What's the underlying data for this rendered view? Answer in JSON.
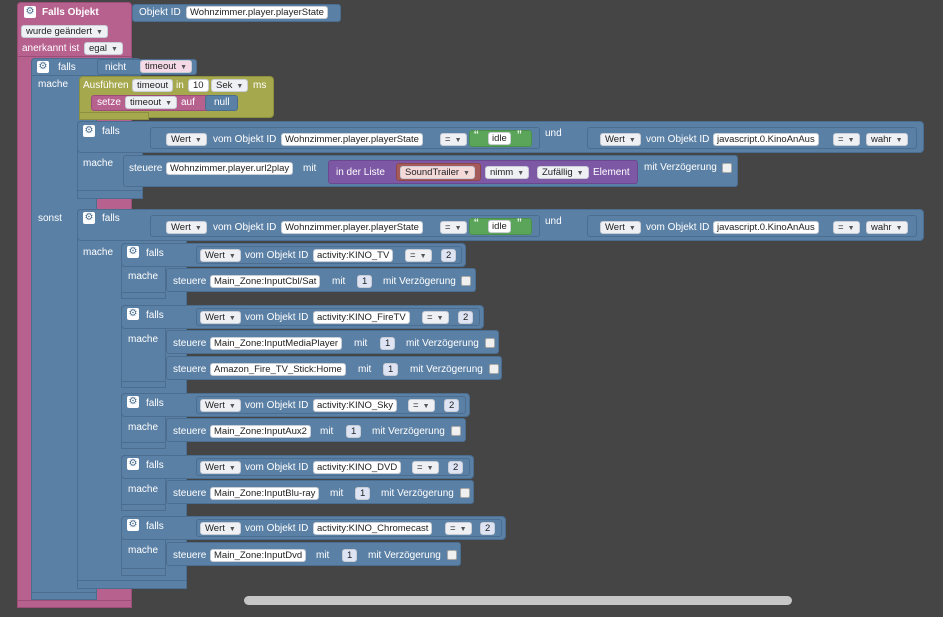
{
  "header": {
    "falls_objekt": "Falls Objekt",
    "objekt_id_label": "Objekt ID",
    "objekt_id_value": "Wohnzimmer.player.playerState",
    "wurde_geaendert": "wurde geändert",
    "anerkannt_ist": "anerkannt ist",
    "egal": "egal"
  },
  "outer_if": {
    "falls": "falls",
    "nicht": "nicht",
    "timeout_var": "timeout",
    "mache": "mache",
    "sonst": "sonst"
  },
  "timer": {
    "ausfuehren": "Ausführen",
    "timeout_var": "timeout",
    "in": "in",
    "value": "10",
    "unit": "Sek",
    "ms": "ms",
    "setze": "setze",
    "setze_var": "timeout",
    "auf": "auf",
    "null": "null"
  },
  "cond": {
    "falls": "falls",
    "mache": "mache",
    "wert": "Wert",
    "vom_objekt_id": "vom Objekt ID",
    "obj1": "Wohnzimmer.player.playerState",
    "op_eq": "=",
    "idle": "idle",
    "und": "und",
    "obj2": "javascript.0.KinoAnAus",
    "wahr": "wahr",
    "quote_open": "“",
    "quote_close": "”"
  },
  "play": {
    "steuere": "steuere",
    "target": "Wohnzimmer.player.url2play",
    "mit": "mit",
    "in_der_liste": "in der Liste",
    "list_var": "SoundTrailer",
    "nimm": "nimm",
    "zufaellig": "Zufällig",
    "element": "Element",
    "mit_verzoegerung": "mit Verzögerung"
  },
  "branches": [
    {
      "obj": "activity:KINO_TV",
      "val": "2",
      "actions": [
        {
          "target": "Main_Zone:InputCbl/Sat",
          "val": "1"
        }
      ]
    },
    {
      "obj": "activity:KINO_FireTV",
      "val": "2",
      "actions": [
        {
          "target": "Main_Zone:InputMediaPlayer",
          "val": "1"
        },
        {
          "target": "Amazon_Fire_TV_Stick:Home",
          "val": "1"
        }
      ]
    },
    {
      "obj": "activity:KINO_Sky",
      "val": "2",
      "actions": [
        {
          "target": "Main_Zone:InputAux2",
          "val": "1"
        }
      ]
    },
    {
      "obj": "activity:KINO_DVD",
      "val": "2",
      "actions": [
        {
          "target": "Main_Zone:InputBlu-ray",
          "val": "1"
        }
      ]
    },
    {
      "obj": "activity:KINO_Chromecast",
      "val": "2",
      "actions": [
        {
          "target": "Main_Zone:InputDvd",
          "val": "1"
        }
      ]
    }
  ],
  "colors": {
    "event": "#b7618f",
    "logic": "#5b80a5",
    "timer": "#a5a84d",
    "list": "#7c58a5",
    "text": "#5ba55b",
    "background": "#454545"
  }
}
